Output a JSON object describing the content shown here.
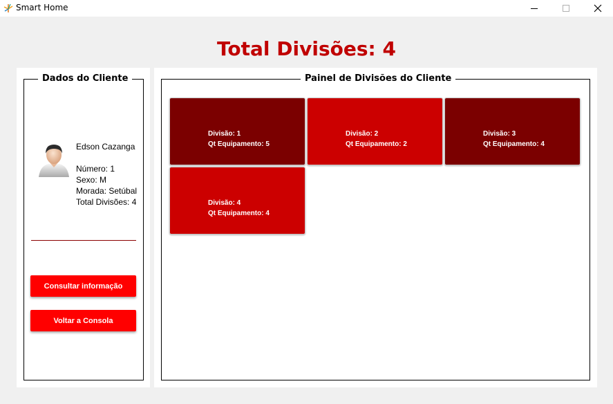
{
  "window": {
    "title": "Smart Home"
  },
  "header": {
    "total_title": "Total Divisões: 4"
  },
  "client_panel": {
    "legend": "Dados do Cliente",
    "name": "Edson Cazanga",
    "numero": "Número: 1",
    "sexo": "Sexo: M",
    "morada": "Morada: Setúbal",
    "total": "Total Divisões: 4",
    "buttons": {
      "consultar": "Consultar informação",
      "voltar": "Voltar a Consola"
    }
  },
  "divisions_panel": {
    "legend": "Painel de Divisões do Cliente",
    "tiles": [
      {
        "division": "Divisão: 1",
        "equipment": "Qt Equipamento: 5",
        "color": "#7b0000"
      },
      {
        "division": "Divisão: 2",
        "equipment": "Qt Equipamento: 2",
        "color": "#cc0000"
      },
      {
        "division": "Divisão: 3",
        "equipment": "Qt Equipamento: 4",
        "color": "#7b0000"
      },
      {
        "division": "Divisão: 4",
        "equipment": "Qt Equipamento: 4",
        "color": "#cc0000"
      }
    ]
  },
  "colors": {
    "accent_red": "#c00000",
    "button_red": "#ff0000"
  }
}
